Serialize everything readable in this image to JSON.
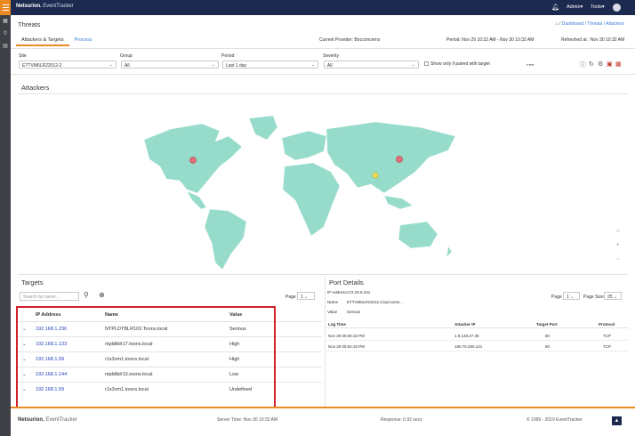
{
  "topbar": {
    "brand_main": "Netsurion.",
    "brand_sub": "EventTracker",
    "nav_admin": "Admin▾",
    "nav_tools": "Tools▾"
  },
  "page": {
    "title": "Threats",
    "breadcrumb": "Dashboard / Threats / Attackers"
  },
  "tabs": [
    "Attackers & Targets",
    "Process"
  ],
  "info": {
    "provider": "Current Provider: Bocconcerns",
    "period": "Period: Nov 29 10:32 AM - Nov 30 10:32 AM",
    "refreshed": "Refreshed at : Nov 30 10:32 AM"
  },
  "filters": {
    "site_label": "Site",
    "site_value": "ETTVM6LR22012-2",
    "group_label": "Group",
    "group_value": "All",
    "period_label": "Period",
    "period_value": "Last 1 day",
    "severity_label": "Severity",
    "severity_value": "All",
    "paired_label": "Show only if paired with target"
  },
  "attackers": {
    "title": "Attackers"
  },
  "targets": {
    "title": "Targets",
    "search_placeholder": "Search by name...",
    "page_label": "Page",
    "page_value": "1",
    "columns": [
      "IP Address",
      "Name",
      "Value"
    ],
    "rows": [
      {
        "ip": "192.168.1.236",
        "name": "NTPLDTBLR102.Toons.local",
        "value": "Serious"
      },
      {
        "ip": "192.168.1.133",
        "name": "ntpldtblr17.toons.local",
        "value": "High"
      },
      {
        "ip": "192.168.1.59",
        "name": "r1s3vm1.toons.local",
        "value": "High"
      },
      {
        "ip": "192.168.1.144",
        "name": "ntpldtblr13.toons.local",
        "value": "Low"
      },
      {
        "ip": "192.168.1.59",
        "name": "r1s3vm1.toons.local",
        "value": "Undefined"
      }
    ]
  },
  "port_details": {
    "title": "Port Details",
    "ip_label": "IP Address",
    "ip_value": "172.28.8.161",
    "name_label": "Name",
    "name_value": "ETTVM6LR22012-2.kpi.toons...",
    "value_label": "Value",
    "value_value": "Serious",
    "page_label": "Page",
    "page_value": "1",
    "pagesize_label": "Page Size",
    "pagesize_value": "25",
    "columns": [
      "Log Time",
      "Attacker IP",
      "Target Port",
      "Protocol"
    ],
    "rows": [
      {
        "time": "Nov 29 06:00:33 PM",
        "ip": "1.9.148.27.35",
        "port": "80",
        "protocol": "TCP"
      },
      {
        "time": "Nov 29 05:52:33 PM",
        "ip": "180.76.250.121",
        "port": "80",
        "protocol": "TCP"
      }
    ]
  },
  "footer": {
    "brand_main": "Netsurion.",
    "brand_sub": "EventTracker",
    "server_time": "Server Time: Nov 30 10:32 AM",
    "response": "Response: 0.92 secs",
    "copyright": "© 1999 - 2019 EventTracker"
  },
  "colors": {
    "accent": "#e98a23",
    "nav": "#1b2a4e",
    "map_land": "#97dccb",
    "highlight": "#d21f2a",
    "link": "#1f3fb7"
  }
}
